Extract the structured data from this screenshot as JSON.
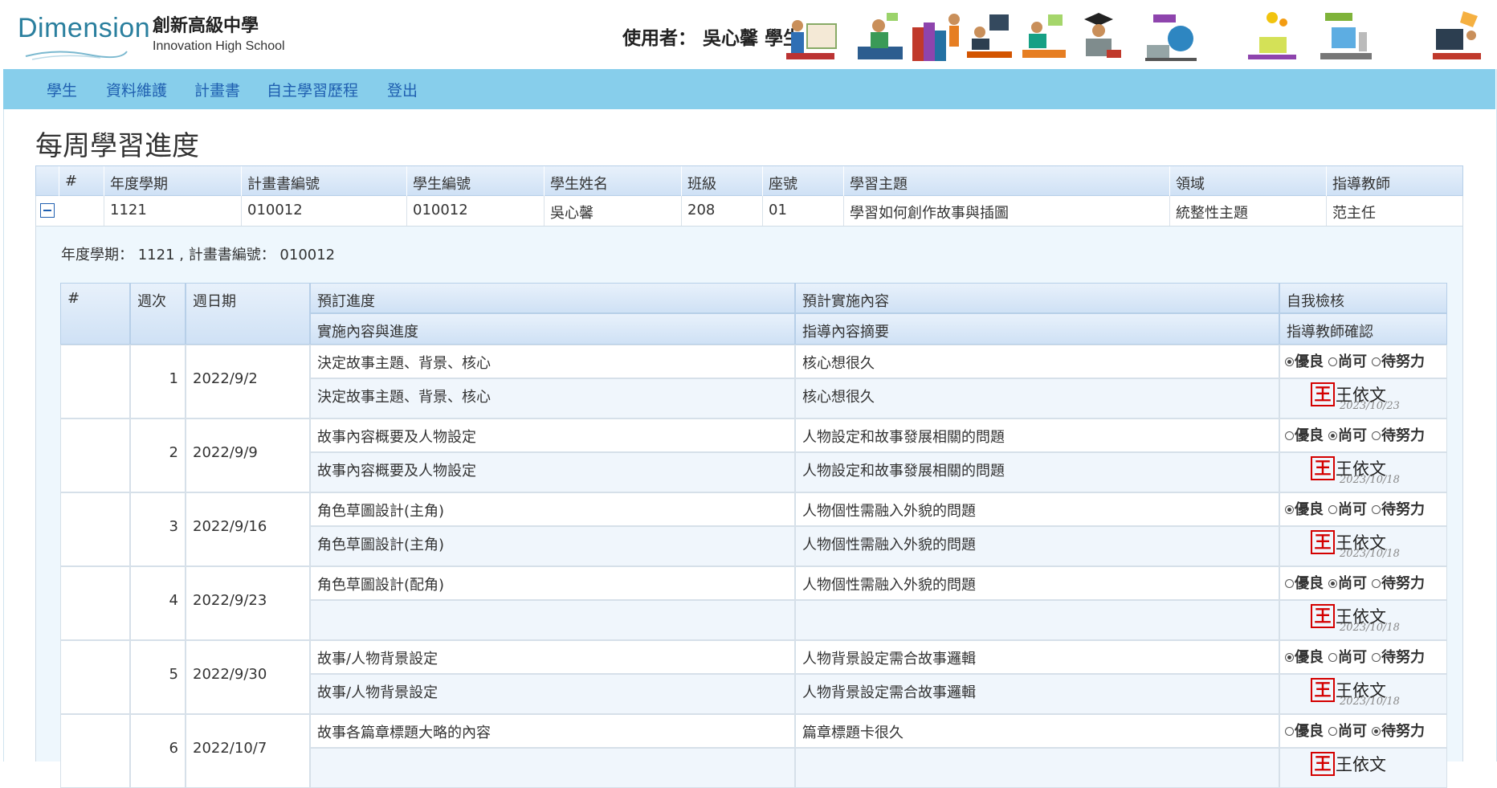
{
  "header": {
    "logo_text": "Dimension",
    "school_zh": "創新高級中學",
    "school_en": "Innovation High School",
    "user_label": "使用者： 吳心馨 學生"
  },
  "nav": [
    "學生",
    "資料維護",
    "計畫書",
    "自主學習歷程",
    "登出"
  ],
  "page_title": "每周學習進度",
  "outer_table": {
    "headers": [
      "#",
      "年度學期",
      "計畫書編號",
      "學生編號",
      "學生姓名",
      "班級",
      "座號",
      "學習主題",
      "領域",
      "指導教師"
    ],
    "row": [
      "",
      "1121",
      "010012",
      "010012",
      "吳心馨",
      "208",
      "01",
      "學習如何創作故事與插圖",
      "統整性主題",
      "范主任"
    ]
  },
  "detail": {
    "caption": "年度學期： 1121 , 計畫書編號： 010012",
    "headers": {
      "num": "#",
      "week": "週次",
      "date": "週日期",
      "planned": "預訂進度",
      "planned_content": "預計實施內容",
      "self_check": "自我檢核",
      "actual": "實施內容與進度",
      "guidance": "指導內容摘要",
      "teacher_confirm": "指導教師確認"
    },
    "rating_options": [
      "優良",
      "尚可",
      "待努力"
    ],
    "teacher_stamp": "王",
    "teacher_name": "王依文",
    "rows": [
      {
        "week": "1",
        "date": "2022/9/2",
        "planned": "決定故事主題、背景、核心",
        "planned_content": "核心想很久",
        "actual": "決定故事主題、背景、核心",
        "guidance": "核心想很久",
        "rating": "優良",
        "sign_date": "2023/10/23"
      },
      {
        "week": "2",
        "date": "2022/9/9",
        "planned": "故事內容概要及人物設定",
        "planned_content": "人物設定和故事發展相關的問題",
        "actual": "故事內容概要及人物設定",
        "guidance": "人物設定和故事發展相關的問題",
        "rating": "尚可",
        "sign_date": "2023/10/18"
      },
      {
        "week": "3",
        "date": "2022/9/16",
        "planned": "角色草圖設計(主角)",
        "planned_content": "人物個性需融入外貌的問題",
        "actual": "角色草圖設計(主角)",
        "guidance": "人物個性需融入外貌的問題",
        "rating": "優良",
        "sign_date": "2023/10/18"
      },
      {
        "week": "4",
        "date": "2022/9/23",
        "planned": "角色草圖設計(配角)",
        "planned_content": "人物個性需融入外貌的問題",
        "actual": "",
        "guidance": "",
        "rating": "尚可",
        "sign_date": "2023/10/18"
      },
      {
        "week": "5",
        "date": "2022/9/30",
        "planned": "故事/人物背景設定",
        "planned_content": "人物背景設定需合故事邏輯",
        "actual": "故事/人物背景設定",
        "guidance": "人物背景設定需合故事邏輯",
        "rating": "優良",
        "sign_date": "2023/10/18"
      },
      {
        "week": "6",
        "date": "2022/10/7",
        "planned": "故事各篇章標題大略的內容",
        "planned_content": "篇章標題卡很久",
        "actual": "",
        "guidance": "",
        "rating": "待努力",
        "sign_date": ""
      }
    ]
  },
  "colors": {
    "nav_bg": "#87ceeb",
    "link": "#1f5fb0",
    "stamp": "#d40000"
  }
}
